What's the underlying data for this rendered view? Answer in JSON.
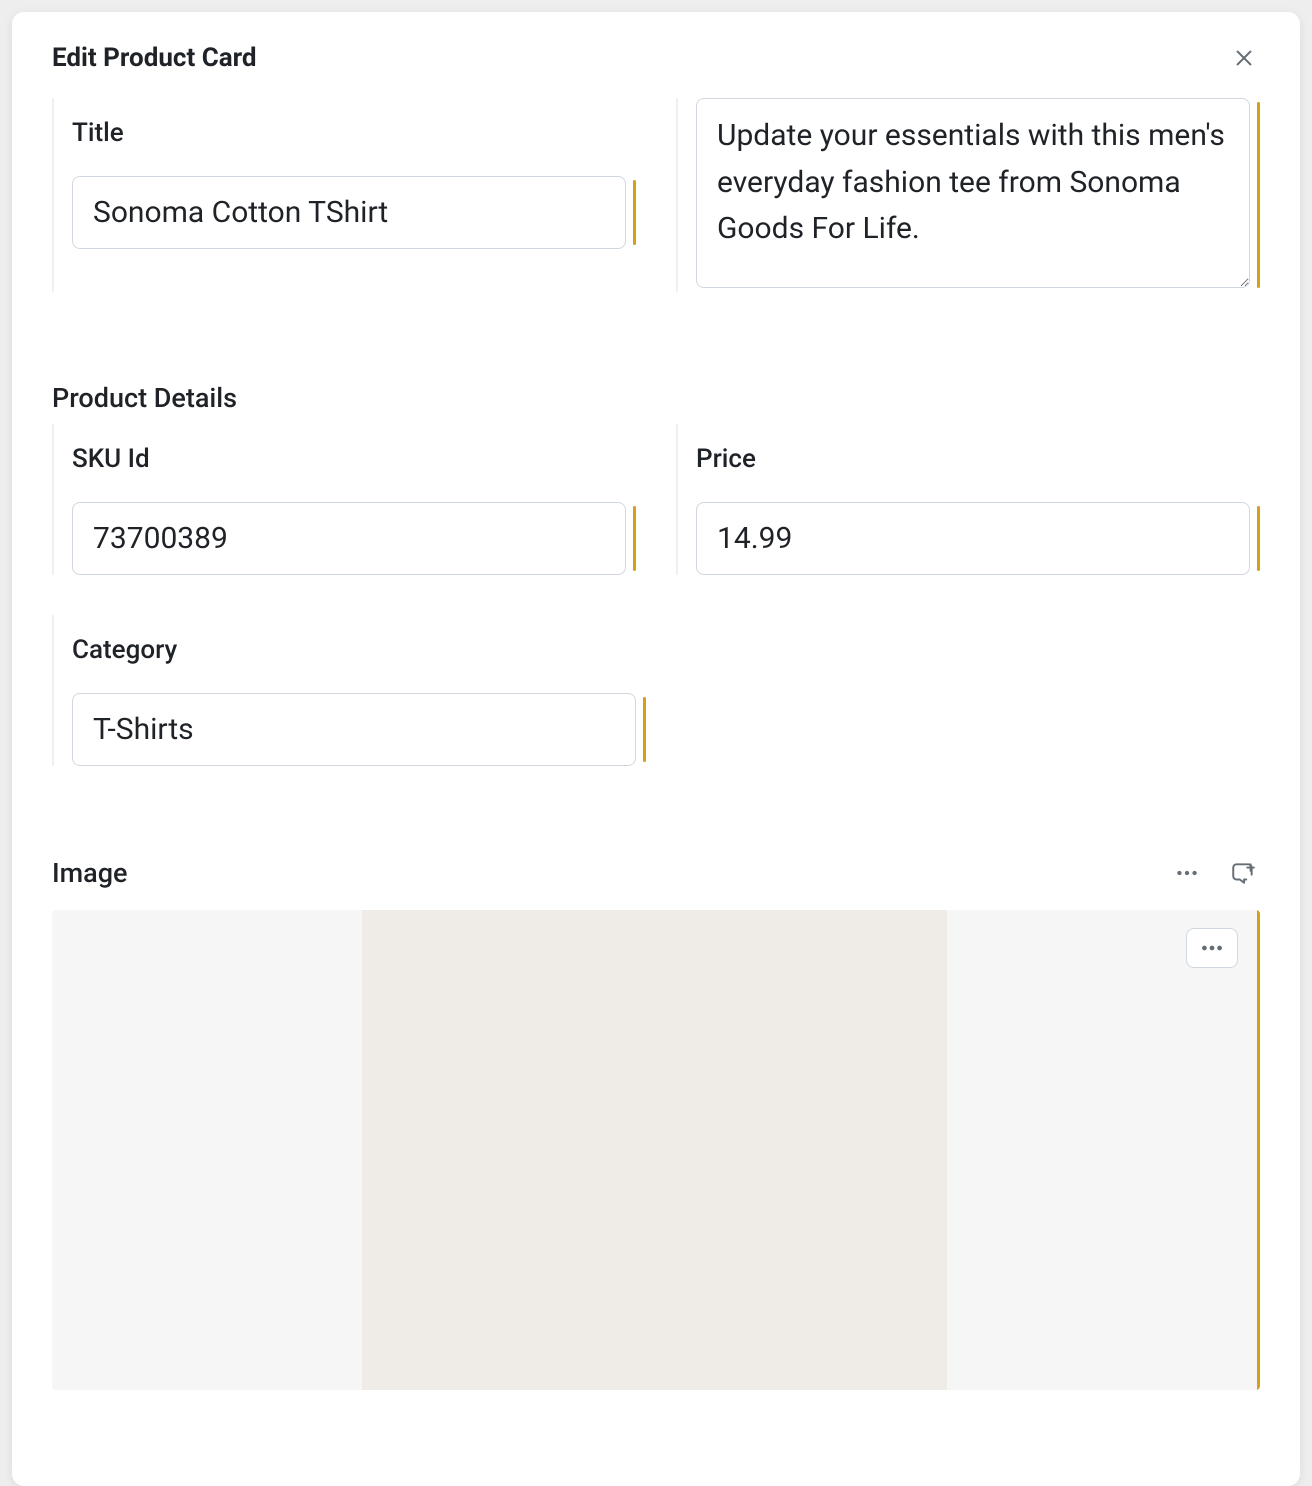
{
  "modal": {
    "title": "Edit Product Card"
  },
  "basic": {
    "title_label": "Title",
    "title_value": "Sonoma Cotton TShirt",
    "description_value": "Update your essentials with this men's everyday fashion tee from Sonoma Goods For Life."
  },
  "details": {
    "section_title": "Product Details",
    "sku_label": "SKU Id",
    "sku_value": "73700389",
    "price_label": "Price",
    "price_value": "14.99",
    "category_label": "Category",
    "category_value": "T-Shirts"
  },
  "image_section": {
    "title": "Image"
  }
}
